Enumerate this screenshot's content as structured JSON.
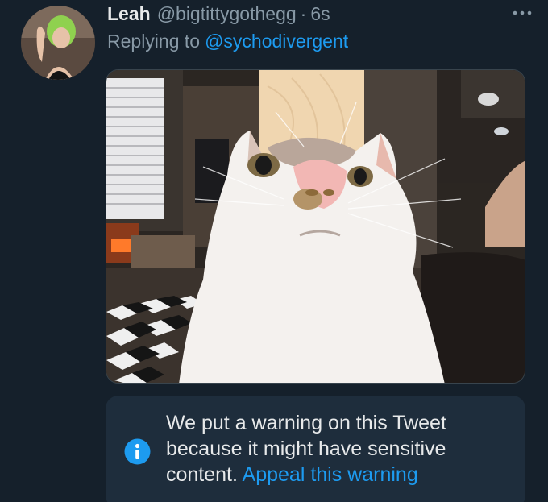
{
  "tweet": {
    "author_name": "Leah",
    "author_handle": "@bigtittygothegg",
    "separator": "·",
    "time": "6s",
    "replying_label": "Replying to",
    "replying_to": "@sychodivergent",
    "more_icon": "more-dots-icon"
  },
  "media": {
    "subject": "cat-photo"
  },
  "warning": {
    "icon": "info-icon",
    "message": "We put a warning on this Tweet because it might have sensitive content.",
    "appeal_link": "Appeal this warning"
  },
  "colors": {
    "background": "#15202b",
    "accent": "#1d9bf0",
    "secondary_text": "#8899a6",
    "warning_bg": "#1e2d3c"
  }
}
